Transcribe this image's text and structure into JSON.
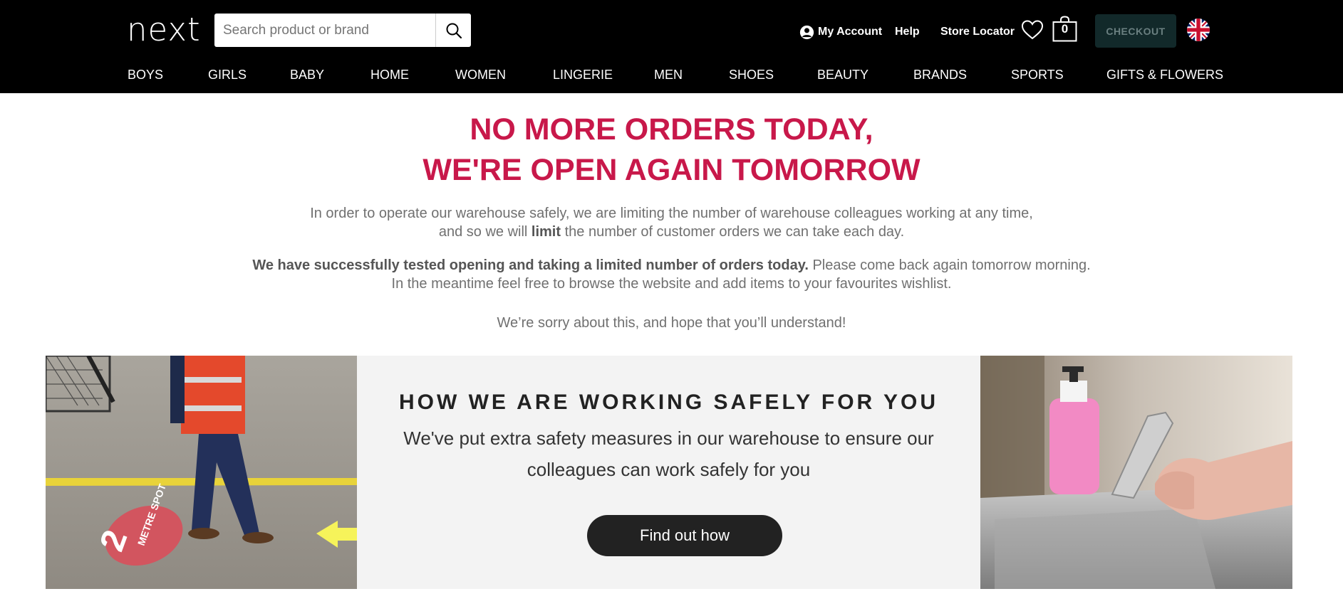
{
  "header": {
    "logo": "next",
    "search": {
      "placeholder": "Search product or brand",
      "value": ""
    },
    "account_label": "My Account",
    "help_label": "Help",
    "store_locator_label": "Store Locator",
    "bag_count": "0",
    "checkout_label": "CHECKOUT",
    "nav": [
      "BOYS",
      "GIRLS",
      "BABY",
      "HOME",
      "WOMEN",
      "LINGERIE",
      "MEN",
      "SHOES",
      "BEAUTY",
      "BRANDS",
      "SPORTS",
      "GIFTS & FLOWERS"
    ]
  },
  "notice": {
    "title_line1": "NO MORE ORDERS TODAY,",
    "title_line2": "WE'RE OPEN AGAIN TOMORROW",
    "p1_line1": "In order to operate our warehouse safely, we are limiting the number of warehouse colleagues working at any time,",
    "p1_line2_pre": "and so we will ",
    "p1_line2_bold": "limit",
    "p1_line2_post": " the number of customer orders we can take each day.",
    "p2_bold": "We have successfully tested opening and taking a limited number of orders today.",
    "p2_rest": " Please come back again tomorrow morning.",
    "p2_line2": "In the meantime feel free to browse the website and add items to your favourites wishlist.",
    "p3": "We’re sorry about this, and hope that you’ll understand!"
  },
  "banner": {
    "title": "HOW WE ARE WORKING SAFELY FOR YOU",
    "text": "We've put extra safety measures in our warehouse to ensure our colleagues can work safely for you",
    "button_label": "Find out how",
    "floor_sticker_text": "2 METRE SPOT"
  },
  "colors": {
    "header_bg": "#000000",
    "title_red": "#c8184a",
    "checkout_bg": "#12292a",
    "button_dark": "#222222",
    "banner_bg": "#f3f3f3"
  }
}
